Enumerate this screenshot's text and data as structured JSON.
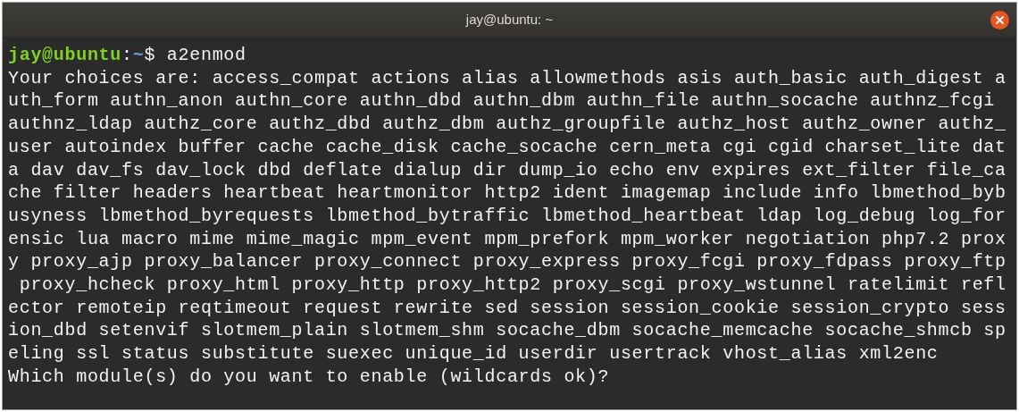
{
  "window": {
    "title": "jay@ubuntu: ~"
  },
  "prompt": {
    "user_host": "jay@ubuntu",
    "separator": ":",
    "path": "~",
    "symbol": "$",
    "command": "a2enmod"
  },
  "output_lines": [
    "Your choices are: access_compat actions alias allowmethods asis auth_basic auth_digest a",
    "uth_form authn_anon authn_core authn_dbd authn_dbm authn_file authn_socache authnz_fcgi",
    "authnz_ldap authz_core authz_dbd authz_dbm authz_groupfile authz_host authz_owner authz_",
    "user autoindex buffer cache cache_disk cache_socache cern_meta cgi cgid charset_lite dat",
    "a dav dav_fs dav_lock dbd deflate dialup dir dump_io echo env expires ext_filter file_ca",
    "che filter headers heartbeat heartmonitor http2 ident imagemap include info lbmethod_byb",
    "usyness lbmethod_byrequests lbmethod_bytraffic lbmethod_heartbeat ldap log_debug log_for",
    "ensic lua macro mime mime_magic mpm_event mpm_prefork mpm_worker negotiation php7.2 prox",
    "y proxy_ajp proxy_balancer proxy_connect proxy_express proxy_fcgi proxy_fdpass proxy_ftp",
    " proxy_hcheck proxy_html proxy_http proxy_http2 proxy_scgi proxy_wstunnel ratelimit refl",
    "ector remoteip reqtimeout request rewrite sed session session_cookie session_crypto sess",
    "ion_dbd setenvif slotmem_plain slotmem_shm socache_dbm socache_memcache socache_shmcb sp",
    "eling ssl status substitute suexec unique_id userdir usertrack vhost_alias xml2enc",
    "Which module(s) do you want to enable (wildcards ok)?"
  ]
}
